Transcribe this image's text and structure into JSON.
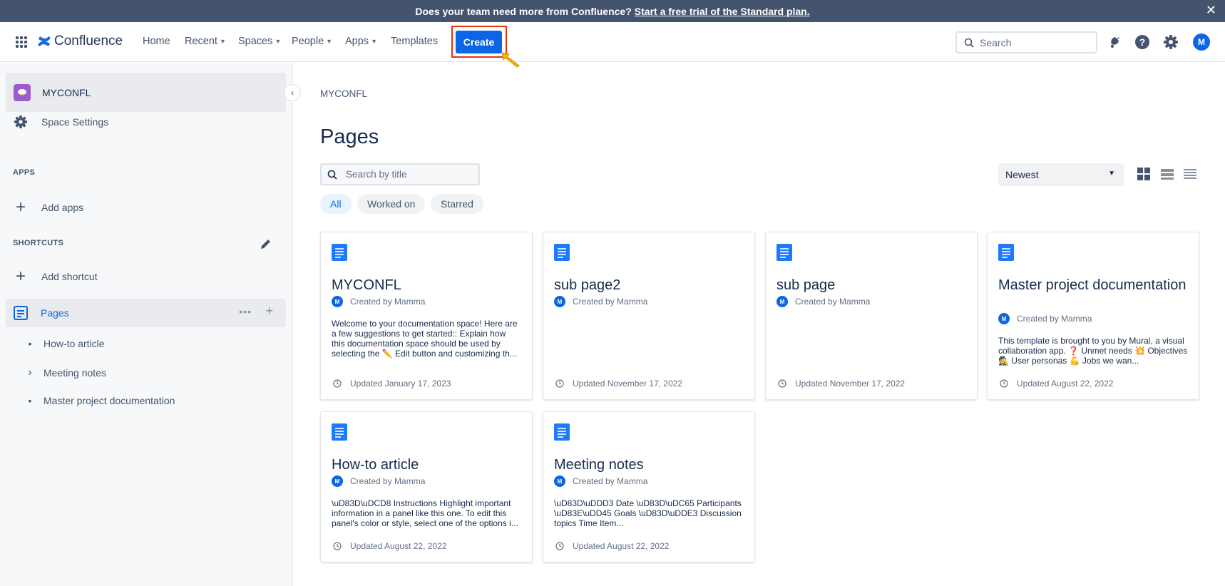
{
  "banner": {
    "text": "Does your team need more from Confluence?",
    "link": "Start a free trial of the Standard plan.",
    "close": "✕"
  },
  "nav": {
    "logo": "Confluence",
    "home": "Home",
    "recent": "Recent",
    "spaces": "Spaces",
    "people": "People",
    "apps": "Apps",
    "templates": "Templates",
    "create": "Create",
    "search_placeholder": "Search",
    "avatar": "M"
  },
  "sidebar": {
    "space_name": "MYCONFL",
    "space_settings": "Space Settings",
    "apps_heading": "APPS",
    "add_apps": "Add apps",
    "shortcuts_heading": "SHORTCUTS",
    "add_shortcut": "Add shortcut",
    "pages": "Pages",
    "dots": "•••",
    "plus": "+",
    "tree": [
      {
        "label": "How-to article",
        "marker": "•"
      },
      {
        "label": "Meeting notes",
        "marker": "›"
      },
      {
        "label": "Master project documentation",
        "marker": "•"
      }
    ]
  },
  "main": {
    "breadcrumb": "MYCONFL",
    "title": "Pages",
    "search_placeholder": "Search by title",
    "sort": "Newest",
    "filters": [
      "All",
      "Worked on",
      "Starred"
    ],
    "cards": [
      {
        "title": "MYCONFL",
        "by": "Created by Mamma",
        "avatar": "M",
        "excerpt": "Welcome to your documentation space! Here are a few suggestions to get started:: Explain how this documentation space should be used by selecting the ✏️ Edit button and customizing th...",
        "updated": "Updated January 17, 2023"
      },
      {
        "title": "sub page2",
        "by": "Created by Mamma",
        "avatar": "M",
        "excerpt": "",
        "updated": "Updated November 17, 2022"
      },
      {
        "title": "sub page",
        "by": "Created by Mamma",
        "avatar": "M",
        "excerpt": "",
        "updated": "Updated November 17, 2022"
      },
      {
        "title": "Master project documentation",
        "by": "Created by Mamma",
        "avatar": "M",
        "excerpt": "This template is brought to you by Mural, a visual collaboration app. ❓ Unmet needs 💥  Objectives 🕵  User personas 💪  Jobs we wan...",
        "updated": "Updated August 22, 2022"
      },
      {
        "title": "How-to article",
        "by": "Created by Mamma",
        "avatar": "M",
        "excerpt": "\\uD83D\\uDCD8  Instructions Highlight important information in a panel like this one. To edit this panel's color or style, select one of the options i...",
        "updated": "Updated August 22, 2022"
      },
      {
        "title": "Meeting notes",
        "by": "Created by Mamma",
        "avatar": "M",
        "excerpt": "\\uD83D\\uDDD3  Date \\uD83D\\uDC65  Participants \\uD83E\\uDD45  Goals \\uD83D\\uDDE3  Discussion topics Time Item...",
        "updated": "Updated August 22, 2022"
      }
    ]
  },
  "colors": {
    "brand": "#0c66e4",
    "banner": "#44546f",
    "highlight_outline": "#de350b",
    "cursor": "#f5b800"
  }
}
